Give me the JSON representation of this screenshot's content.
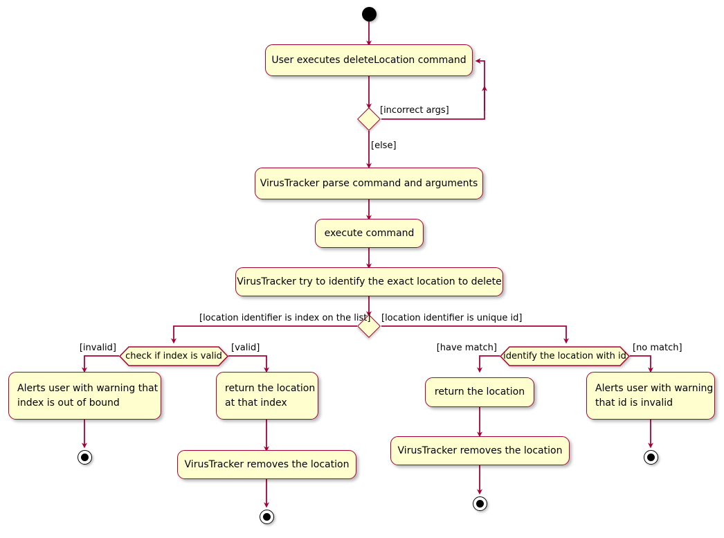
{
  "diagram": {
    "title": "deleteLocation command activity diagram",
    "colors": {
      "node_fill": "#FEFECE",
      "node_border": "#A80036",
      "arrow": "#A80036",
      "text": "#000000",
      "terminator": "#000000",
      "background": "#FFFFFF"
    }
  },
  "nodes": {
    "start": {
      "kind": "start-node",
      "label": ""
    },
    "user_executes": {
      "kind": "activity",
      "label": "User executes deleteLocation command"
    },
    "branch_args": {
      "kind": "decision-diamond",
      "label": ""
    },
    "parse": {
      "kind": "activity",
      "label": "VirusTracker parse command and arguments"
    },
    "execute": {
      "kind": "activity",
      "label": "execute command"
    },
    "identify": {
      "kind": "activity",
      "label": "VirusTracker try to identify the exact location to delete"
    },
    "branch_identifier": {
      "kind": "decision-diamond",
      "label": ""
    },
    "check_index": {
      "kind": "decision-hexagon",
      "label": "check if index is valid"
    },
    "identify_with_id": {
      "kind": "decision-hexagon",
      "label": "identify the location with id"
    },
    "alert_index": {
      "kind": "activity",
      "label": "Alerts user with warning that\nindex is out of bound"
    },
    "return_at_index": {
      "kind": "activity",
      "label": "return the location\nat that index"
    },
    "return_location": {
      "kind": "activity",
      "label": "return the location"
    },
    "alert_id": {
      "kind": "activity",
      "label": "Alerts user with warning\nthat id is invalid"
    },
    "removes_left": {
      "kind": "activity",
      "label": "VirusTracker removes the location"
    },
    "removes_right": {
      "kind": "activity",
      "label": "VirusTracker removes the location"
    },
    "end_1": {
      "kind": "end-node",
      "label": ""
    },
    "end_2": {
      "kind": "end-node",
      "label": ""
    },
    "end_3": {
      "kind": "end-node",
      "label": ""
    },
    "end_4": {
      "kind": "end-node",
      "label": ""
    }
  },
  "edge_labels": {
    "incorrect_args": "[incorrect args]",
    "else": "[else]",
    "identifier_index": "[location identifier is index on the list]",
    "identifier_unique_id": "[location identifier is unique id]",
    "invalid": "[invalid]",
    "valid": "[valid]",
    "have_match": "[have match]",
    "no_match": "[no match]"
  }
}
